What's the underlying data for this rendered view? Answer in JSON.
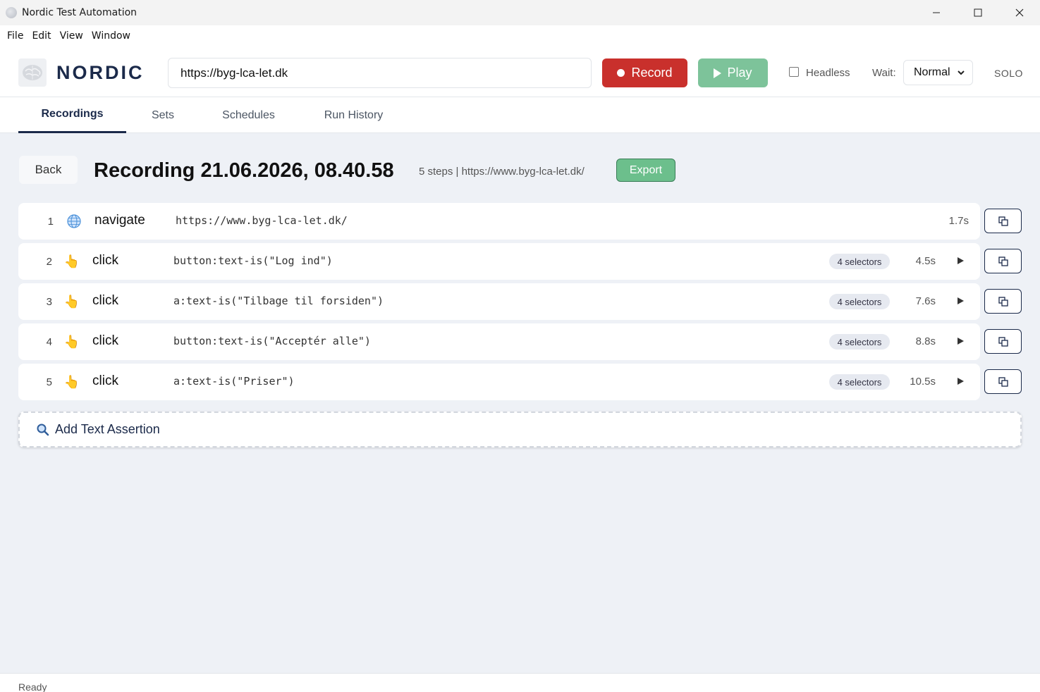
{
  "window": {
    "title": "Nordic Test Automation"
  },
  "menu": [
    "File",
    "Edit",
    "View",
    "Window"
  ],
  "toolbar": {
    "brand": "NORDIC",
    "url_value": "https://byg-lca-let.dk",
    "record_label": "Record",
    "play_label": "Play",
    "headless_label": "Headless",
    "headless_checked": false,
    "wait_label": "Wait:",
    "wait_value": "Normal",
    "mode_label": "SOLO",
    "colors": {
      "record": "#c9302c",
      "play": "#7dc39a",
      "brand": "#1b2a4a"
    }
  },
  "tabs": [
    {
      "label": "Recordings",
      "active": true
    },
    {
      "label": "Sets",
      "active": false
    },
    {
      "label": "Schedules",
      "active": false
    },
    {
      "label": "Run History",
      "active": false
    }
  ],
  "recording": {
    "back_label": "Back",
    "title": "Recording 21.06.2026, 08.40.58",
    "meta": "5 steps | https://www.byg-lca-let.dk/",
    "export_label": "Export",
    "steps": [
      {
        "num": "1",
        "icon": "globe-icon",
        "action": "navigate",
        "target": "https://www.byg-lca-let.dk/",
        "selectors": "",
        "duration": "1.7s"
      },
      {
        "num": "2",
        "icon": "pointing-hand-icon",
        "action": "click",
        "target": "button:text-is(\"Log ind\")",
        "selectors": "4 selectors",
        "duration": "4.5s"
      },
      {
        "num": "3",
        "icon": "pointing-hand-icon",
        "action": "click",
        "target": "a:text-is(\"Tilbage til forsiden\")",
        "selectors": "4 selectors",
        "duration": "7.6s"
      },
      {
        "num": "4",
        "icon": "pointing-hand-icon",
        "action": "click",
        "target": "button:text-is(\"Acceptér alle\")",
        "selectors": "4 selectors",
        "duration": "8.8s"
      },
      {
        "num": "5",
        "icon": "pointing-hand-icon",
        "action": "click",
        "target": "a:text-is(\"Priser\")",
        "selectors": "4 selectors",
        "duration": "10.5s"
      }
    ],
    "add_assertion_label": "Add Text Assertion"
  },
  "status": {
    "text": "Ready"
  }
}
